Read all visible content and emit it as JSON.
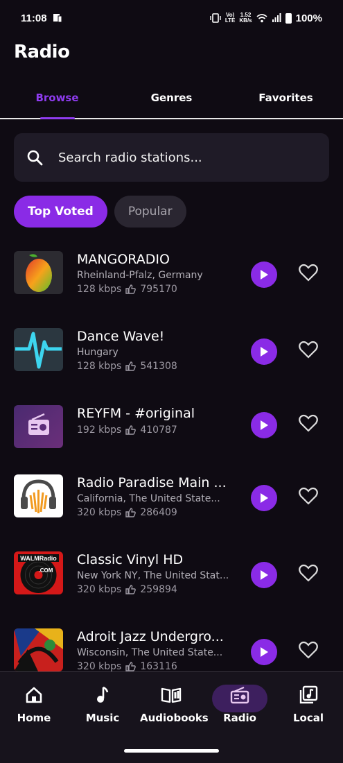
{
  "status_bar": {
    "time": "11:08",
    "network_top": "Vo)",
    "network_bottom": "LTE",
    "speed_top": "1.52",
    "speed_bottom": "KB/s",
    "battery": "100%"
  },
  "header": {
    "title": "Radio"
  },
  "tabs": [
    {
      "label": "Browse",
      "active": true
    },
    {
      "label": "Genres",
      "active": false
    },
    {
      "label": "Favorites",
      "active": false
    }
  ],
  "search": {
    "placeholder": "Search radio stations..."
  },
  "filters": [
    {
      "label": "Top Voted",
      "active": true
    },
    {
      "label": "Popular",
      "active": false
    }
  ],
  "stations": [
    {
      "name": "MANGORADIO",
      "location": "Rheinland-Pfalz, Germany",
      "bitrate": "128 kbps",
      "votes": "795170",
      "thumb": "mango-logo"
    },
    {
      "name": "Dance Wave!",
      "location": "Hungary",
      "bitrate": "128 kbps",
      "votes": "541308",
      "thumb": "wave-logo"
    },
    {
      "name": "REYFM - #original",
      "location": "",
      "bitrate": "192 kbps",
      "votes": "410787",
      "thumb": "radio-placeholder-icon"
    },
    {
      "name": "Radio Paradise Main ...",
      "location": "California, The United State...",
      "bitrate": "320 kbps",
      "votes": "286409",
      "thumb": "headphones-logo"
    },
    {
      "name": "Classic Vinyl HD",
      "location": "New York NY, The United Stat...",
      "bitrate": "320 kbps",
      "votes": "259894",
      "thumb": "vinyl-logo",
      "thumb_text": "WALMRadio",
      "thumb_text2": ".COM"
    },
    {
      "name": "Adroit Jazz Undergro...",
      "location": "Wisconsin, The United State...",
      "bitrate": "320 kbps",
      "votes": "163116",
      "thumb": "jazz-art"
    }
  ],
  "bottom_nav": [
    {
      "label": "Home",
      "icon": "home-icon",
      "active": false
    },
    {
      "label": "Music",
      "icon": "music-note-icon",
      "active": false
    },
    {
      "label": "Audiobooks",
      "icon": "book-icon",
      "active": false
    },
    {
      "label": "Radio",
      "icon": "radio-icon",
      "active": true
    },
    {
      "label": "Local",
      "icon": "music-library-icon",
      "active": false
    }
  ],
  "colors": {
    "accent": "#8a2be6",
    "background": "#0f0b13",
    "card": "#1f1b27"
  }
}
